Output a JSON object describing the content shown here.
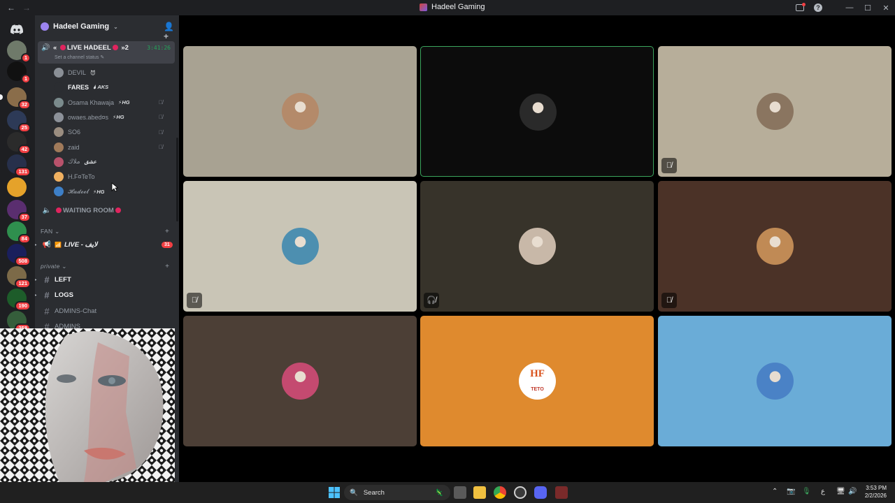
{
  "window": {
    "title": "Hadeel Gaming"
  },
  "server": {
    "name": "Hadeel Gaming"
  },
  "rail": {
    "servers": [
      {
        "badge": "1",
        "color": "#6f7a6a"
      },
      {
        "badge": "1",
        "color": "#111111"
      },
      {
        "badge": "32",
        "color": "#8a6d4a"
      },
      {
        "badge": "25",
        "color": "#2d3a57"
      },
      {
        "badge": "42",
        "color": "#2b2b2b"
      },
      {
        "badge": "131",
        "color": "#27304b"
      },
      {
        "badge": "",
        "color": "#e5a22a"
      },
      {
        "badge": "37",
        "color": "#5a2e6f"
      },
      {
        "badge": "84",
        "color": "#2f8f4e"
      },
      {
        "badge": "508",
        "color": "#1a1f5c"
      },
      {
        "badge": "121",
        "color": "#7c6a48"
      },
      {
        "badge": "190",
        "color": "#1d5c2a"
      },
      {
        "badge": "258",
        "color": "#355e3b"
      }
    ]
  },
  "sidebar": {
    "live_channel": {
      "prefix": "«",
      "name": "LIVE HADEEL",
      "suffix": "»2",
      "timer": "3:41:26",
      "status": "Set a channel status"
    },
    "members": [
      {
        "name": "DEVIL",
        "tag": "😈",
        "bold": false,
        "muted": false,
        "av": "#8a8f96"
      },
      {
        "name": "FARES",
        "tag": "🌢 AKS",
        "bold": true,
        "muted": false,
        "av": "#2b2d31"
      },
      {
        "name": "Osama Khawaja",
        "tag": "⚡HG",
        "bold": false,
        "muted": true,
        "av": "#7a8a8c"
      },
      {
        "name": "owaes.abed¤s",
        "tag": "⚡HG",
        "bold": false,
        "muted": true,
        "av": "#8c9199"
      },
      {
        "name": "SO6",
        "tag": "",
        "bold": false,
        "muted": true,
        "av": "#9a8d80"
      },
      {
        "name": "zaid",
        "tag": "",
        "bold": false,
        "muted": true,
        "av": "#a07a5a"
      },
      {
        "name": "ملاك",
        "tag": "عشق",
        "bold": false,
        "muted": false,
        "av": "#b8526b"
      },
      {
        "name": "H.F¤TeTo",
        "tag": "",
        "bold": false,
        "muted": false,
        "av": "#f0b060"
      },
      {
        "name": "𝓗𝓪𝓭𝓮𝓮𝓵",
        "tag": "⚡HG",
        "bold": false,
        "muted": false,
        "av": "#3d7fc7"
      }
    ],
    "waiting_room": "WAITING ROOM",
    "categories": [
      {
        "name": "FAN"
      },
      {
        "name": "private"
      }
    ],
    "fan_channel": {
      "name": "LIVE - لايف",
      "badge": "31"
    },
    "private_channels": [
      {
        "name": "LEFT",
        "bold": true
      },
      {
        "name": "LOGS",
        "bold": true
      },
      {
        "name": "ADMINS-Chat",
        "bold": false
      },
      {
        "name": "ADMINS",
        "bold": false
      }
    ]
  },
  "tiles": [
    {
      "bg": "#a8a292",
      "avatar": "#b48a6a",
      "speaking": false,
      "mic": ""
    },
    {
      "bg": "#0c0c0c",
      "avatar": "#2a2a2a",
      "speaking": true,
      "mic": ""
    },
    {
      "bg": "#b7ae9a",
      "avatar": "#8a7560",
      "speaking": false,
      "mic": "🎙̸"
    },
    {
      "bg": "#c9c5b6",
      "avatar": "#4d8fb0",
      "speaking": false,
      "mic": "🎙̸"
    },
    {
      "bg": "#37332a",
      "avatar": "#c8b8a8",
      "speaking": false,
      "mic": "🎧̸"
    },
    {
      "bg": "#4b3227",
      "avatar": "#c08a55",
      "speaking": false,
      "mic": "🎙̸"
    },
    {
      "bg": "#4c3f36",
      "avatar": "#c44a70",
      "speaking": false,
      "mic": ""
    },
    {
      "bg": "#df8a2e",
      "avatar": "#ffffff",
      "speaking": false,
      "mic": "",
      "logo": "HF",
      "logo_sub": "TETO"
    },
    {
      "bg": "#6aacd7",
      "avatar": "#4a82c6",
      "speaking": false,
      "mic": ""
    }
  ],
  "taskbar": {
    "search_placeholder": "Search",
    "time": "3:53 PM",
    "date": "2/2/2026",
    "lang": "ع"
  }
}
